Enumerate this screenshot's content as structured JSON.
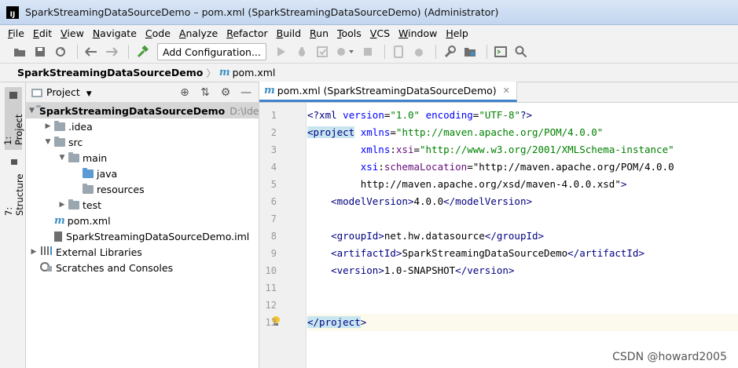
{
  "window": {
    "title": "SparkStreamingDataSourceDemo – pom.xml (SparkStreamingDataSourceDemo) (Administrator)",
    "logo": "IJ"
  },
  "menu": [
    {
      "label": "File"
    },
    {
      "label": "Edit"
    },
    {
      "label": "View"
    },
    {
      "label": "Navigate"
    },
    {
      "label": "Code"
    },
    {
      "label": "Analyze"
    },
    {
      "label": "Refactor"
    },
    {
      "label": "Build"
    },
    {
      "label": "Run"
    },
    {
      "label": "Tools"
    },
    {
      "label": "VCS"
    },
    {
      "label": "Window"
    },
    {
      "label": "Help"
    }
  ],
  "toolbar": {
    "run_config_label": "Add Configuration...",
    "icons": [
      "open-folder-icon",
      "save-icon",
      "sync-icon",
      "back-arrow-icon",
      "forward-arrow-icon",
      "build-hammer-icon",
      "run-icon",
      "debug-icon",
      "coverage-icon",
      "profile-icon",
      "stop-icon",
      "device-icon",
      "bug-icon",
      "settings-wrench-icon",
      "project-structure-icon",
      "terminal-icon",
      "search-icon"
    ]
  },
  "breadcrumb": {
    "project": "SparkStreamingDataSourceDemo",
    "file": "pom.xml"
  },
  "toolstrip": {
    "project_tab": "1: Project",
    "structure_tab": "7: Structure"
  },
  "project_panel": {
    "title": "Project",
    "tree": [
      {
        "label": "SparkStreamingDataSourceDemo",
        "hint": "D:\\IdeaP",
        "expanded": true,
        "selected": true
      },
      {
        "label": ".idea",
        "expanded": false
      },
      {
        "label": "src",
        "expanded": true
      },
      {
        "label": "main",
        "expanded": true
      },
      {
        "label": "java"
      },
      {
        "label": "resources"
      },
      {
        "label": "test",
        "expanded": false
      },
      {
        "label": "pom.xml"
      },
      {
        "label": "SparkStreamingDataSourceDemo.iml"
      },
      {
        "label": "External Libraries",
        "expanded": false
      },
      {
        "label": "Scratches and Consoles"
      }
    ]
  },
  "editor": {
    "tab_label": "pom.xml (SparkStreamingDataSourceDemo)",
    "current_line": 13,
    "lines": [
      {
        "n": "1",
        "text": "<?xml version=\"1.0\" encoding=\"UTF-8\"?>"
      },
      {
        "n": "2",
        "text": "<project xmlns=\"http://maven.apache.org/POM/4.0.0\""
      },
      {
        "n": "3",
        "text": "         xmlns:xsi=\"http://www.w3.org/2001/XMLSchema-instance\""
      },
      {
        "n": "4",
        "text": "         xsi:schemaLocation=\"http://maven.apache.org/POM/4.0.0"
      },
      {
        "n": "5",
        "text": "         http://maven.apache.org/xsd/maven-4.0.0.xsd\">"
      },
      {
        "n": "6",
        "text": "    <modelVersion>4.0.0</modelVersion>"
      },
      {
        "n": "7",
        "text": ""
      },
      {
        "n": "8",
        "text": "    <groupId>net.hw.datasource</groupId>"
      },
      {
        "n": "9",
        "text": "    <artifactId>SparkStreamingDataSourceDemo</artifactId>"
      },
      {
        "n": "10",
        "text": "    <version>1.0-SNAPSHOT</version>"
      },
      {
        "n": "11",
        "text": ""
      },
      {
        "n": "12",
        "text": ""
      },
      {
        "n": "13",
        "text": "</project>"
      }
    ]
  },
  "watermark": "CSDN @howard2005",
  "colors": {
    "accent_tab_underline": "#4083c9",
    "xml_tag": "#000080",
    "xml_value": "#008000",
    "xml_attr": "#0000ff",
    "xml_namespace": "#660e7a"
  }
}
